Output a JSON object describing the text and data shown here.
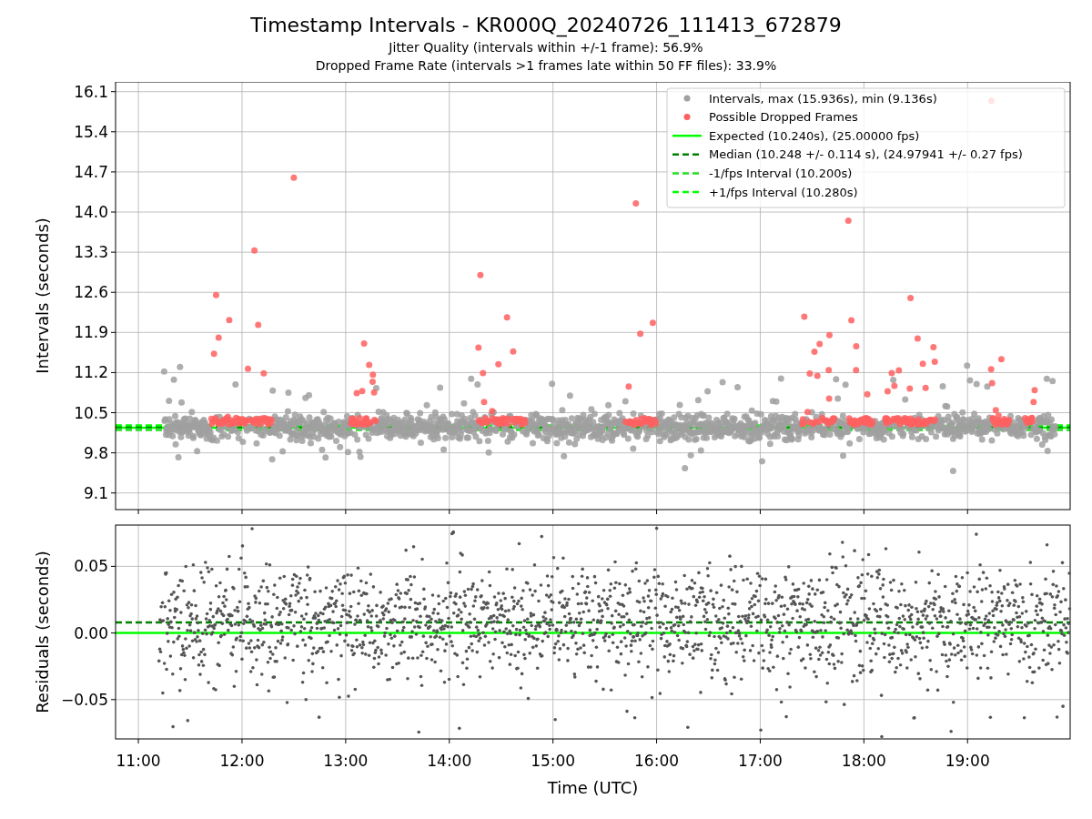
{
  "figure": {
    "title": "Timestamp Intervals - KR000Q_20240726_111413_672879",
    "subtitles": [
      "Jitter Quality (intervals within +/-1 frame): 56.9%",
      "Dropped Frame Rate (intervals >1 frames late within 50 FF files): 33.9%"
    ]
  },
  "top_plot": {
    "point_series": [
      {
        "name": "Intervals, max (15.936s), min (9.136s)",
        "color": "#a0a0a0"
      },
      {
        "name": "Possible Dropped Frames",
        "color": "#ff6060"
      }
    ],
    "chart_data": {
      "type": "scatter",
      "grid": true,
      "ylabel": "Intervals (seconds)",
      "xlim": [
        10.78,
        19.99
      ],
      "ylim": [
        8.81,
        16.27
      ],
      "yticks": [
        {
          "value": 9.1,
          "label": "9.1"
        },
        {
          "value": 9.8,
          "label": "9.8"
        },
        {
          "value": 10.5,
          "label": "10.5"
        },
        {
          "value": 11.2,
          "label": "11.2"
        },
        {
          "value": 11.9,
          "label": "11.9"
        },
        {
          "value": 12.6,
          "label": "12.6"
        },
        {
          "value": 13.3,
          "label": "13.3"
        },
        {
          "value": 14.0,
          "label": "14.0"
        },
        {
          "value": 14.7,
          "label": "14.7"
        },
        {
          "value": 15.4,
          "label": "15.4"
        },
        {
          "value": 16.1,
          "label": "16.1"
        }
      ],
      "x": [
        10.78,
        19.99
      ],
      "series": [
        {
          "name": "Expected (10.240s), (25.00000 fps)",
          "type": "line",
          "line_style": "solid",
          "color": "#00ff00",
          "values": [
            10.24,
            10.24
          ]
        },
        {
          "name": "Median (10.248 +/- 0.114 s), (24.97941 +/- 0.27 fps)",
          "type": "line",
          "line_style": "dashed",
          "color": "#008000",
          "values": [
            10.25,
            10.25
          ]
        },
        {
          "name": "-1/fps Interval (10.200s)",
          "type": "line",
          "line_style": "dashed",
          "color": "#22dd22",
          "values": [
            10.2,
            10.2
          ]
        },
        {
          "name": "+1/fps Interval (10.280s)",
          "type": "line",
          "line_style": "dashed",
          "color": "#00ff00",
          "values": [
            10.28,
            10.28
          ]
        }
      ]
    }
  },
  "bottom_plot": {
    "chart_data": {
      "type": "scatter",
      "grid": true,
      "xlabel": "Time (UTC)",
      "ylabel": "Residuals (seconds)",
      "xlim": [
        10.78,
        19.99
      ],
      "ylim": [
        -0.0795,
        0.081
      ],
      "xticks": [
        {
          "value": 11,
          "label": "11:00"
        },
        {
          "value": 12,
          "label": "12:00"
        },
        {
          "value": 13,
          "label": "13:00"
        },
        {
          "value": 14,
          "label": "14:00"
        },
        {
          "value": 15,
          "label": "15:00"
        },
        {
          "value": 16,
          "label": "16:00"
        },
        {
          "value": 17,
          "label": "17:00"
        },
        {
          "value": 18,
          "label": "18:00"
        },
        {
          "value": 19,
          "label": "19:00"
        }
      ],
      "yticks": [
        {
          "value": -0.05,
          "label": "−0.05"
        },
        {
          "value": 0,
          "label": "0.00"
        },
        {
          "value": 0.05,
          "label": "0.05"
        }
      ],
      "x": [
        10.78,
        19.99
      ],
      "series": [
        {
          "type": "line",
          "line_style": "solid",
          "color": "#00ff00",
          "values": [
            0,
            0
          ]
        },
        {
          "type": "line",
          "line_style": "dashed",
          "color": "#008000",
          "values": [
            0.008,
            0.008
          ]
        }
      ]
    }
  }
}
